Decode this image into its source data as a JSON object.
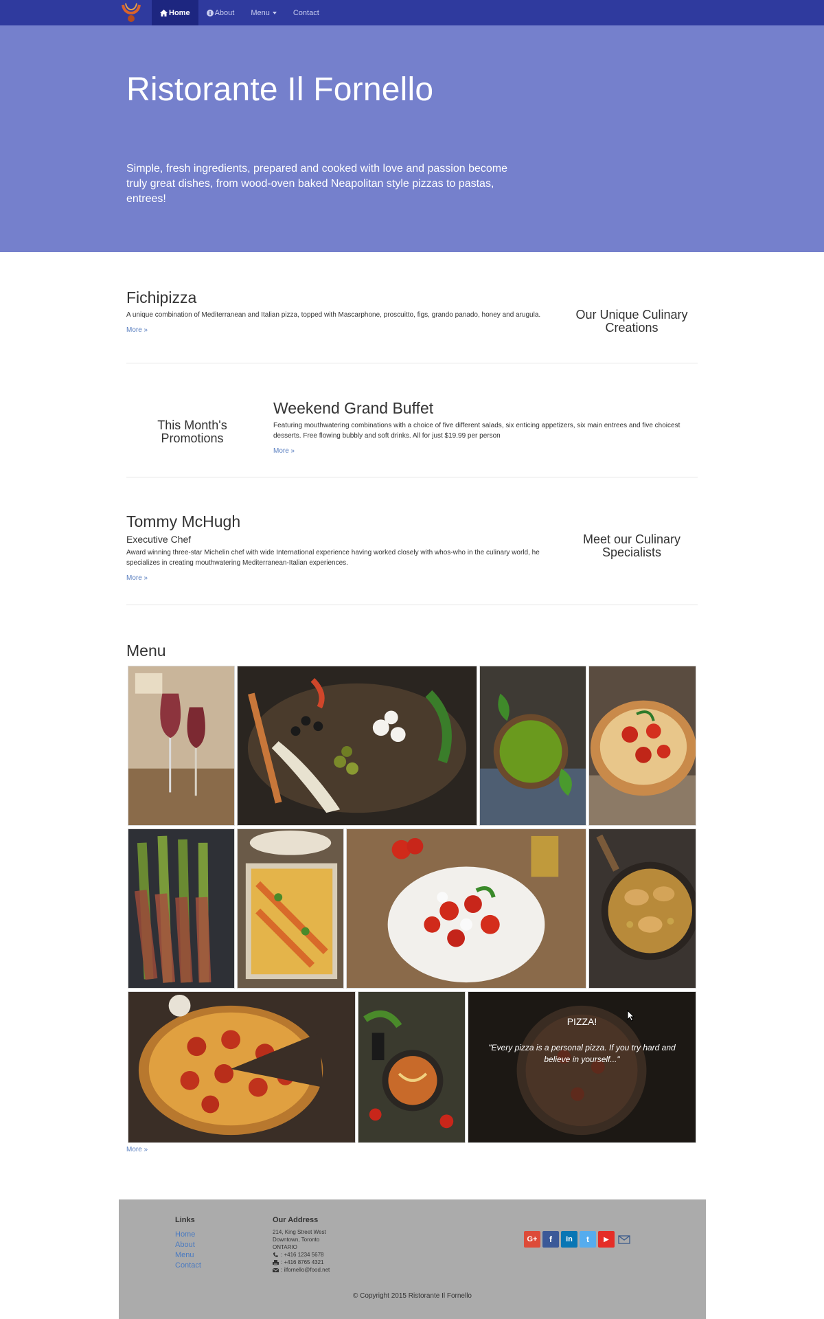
{
  "nav": {
    "items": [
      {
        "label": "Home",
        "icon": "home-icon"
      },
      {
        "label": "About",
        "icon": "info-icon"
      },
      {
        "label": "Menu",
        "icon": "chevron-down-icon"
      },
      {
        "label": "Contact"
      }
    ]
  },
  "jumbotron": {
    "title": "Ristorante Il Fornello",
    "text": "Simple, fresh ingredients, prepared and cooked with love and passion become truly great dishes, from wood-oven baked Neapolitan style pizzas to pastas, entrees!"
  },
  "feature": {
    "title": "Fichipizza",
    "text": "A unique combination of Mediterranean and Italian pizza, topped with Mascarphone, proscuitto, figs, grando panado, honey and arugula.",
    "more": "More »",
    "side_label": "Our Unique Culinary Creations"
  },
  "promotion": {
    "title": "Weekend Grand Buffet",
    "text": "Featuring mouthwatering combinations with a choice of five different salads, six enticing appetizers, six main entrees and five choicest desserts. Free flowing bubbly and soft drinks. All for just $19.99 per person",
    "more": "More »",
    "side_label": "This Month's Promotions"
  },
  "chef": {
    "name": "Tommy McHugh",
    "role": "Executive Chef",
    "text": "Award winning three-star Michelin chef with wide International experience having worked closely with whos-who in the culinary world, he specializes in creating mouthwatering Mediterranean-Italian experiences.",
    "more": "More »",
    "side_label": "Meet our Culinary Specialists"
  },
  "menu": {
    "title": "Menu",
    "more": "More »",
    "pizza_title": "PIZZA!",
    "pizza_quote": "\"Every pizza is a personal pizza. If you try hard and believe in yourself...\""
  },
  "footer": {
    "links_title": "Links",
    "links": [
      "Home",
      "About",
      "Menu",
      "Contact"
    ],
    "address_title": "Our Address",
    "address": [
      "214, King Street West",
      "Downtown, Toronto",
      "ONTARIO"
    ],
    "phone": ": +416 1234 5678",
    "fax": ": +416 8765 4321",
    "email": ": ilfornello@food.net",
    "copyright": "© Copyright 2015 Ristorante Il Fornello",
    "social": [
      {
        "icon": "google-plus-icon",
        "glyph": "G+",
        "color": "#dd4b39"
      },
      {
        "icon": "facebook-icon",
        "glyph": "f",
        "color": "#3b5998"
      },
      {
        "icon": "linkedin-icon",
        "glyph": "in",
        "color": "#0976b4"
      },
      {
        "icon": "twitter-icon",
        "glyph": "t",
        "color": "#55acee"
      },
      {
        "icon": "youtube-icon",
        "glyph": "▶",
        "color": "#e52d27"
      }
    ]
  }
}
